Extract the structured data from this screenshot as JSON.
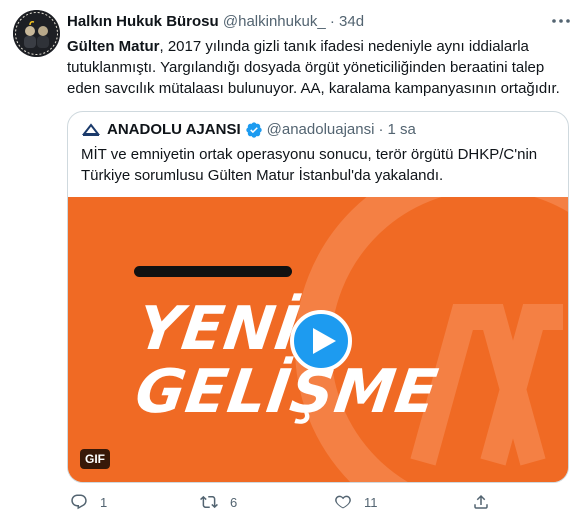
{
  "tweet": {
    "author_name": "Halkın Hukuk Bürosu",
    "author_handle": "@halkinhukuk_",
    "separator": "·",
    "time": "34d",
    "text_bold": "Gülten Matur",
    "text_rest": ", 2017 yılında gizli tanık ifadesi nedeniyle aynı iddialarla tutuklanmıştı. Yargılandığı dosyada örgüt yöneticiliğinden beraatini talep eden savcılık mütalaası bulunuyor. AA, karalama kampanyasının ortağıdır."
  },
  "quote": {
    "name": "ANADOLU AJANSI",
    "handle": "@anadoluajansi",
    "separator": "·",
    "time": "1 sa",
    "text": "MİT ve emniyetin ortak operasyonu sonucu, terör örgütü DHKP/C'nin Türkiye sorumlusu Gülten Matur İstanbul'da yakalandı.",
    "media": {
      "line1": "YENİ",
      "line2": "GELİŞME",
      "badge": "GIF",
      "background_color": "#f06a24"
    }
  },
  "actions": {
    "reply_count": "1",
    "retweet_count": "6",
    "like_count": "11"
  },
  "colors": {
    "verified": "#1d9bf0",
    "secondary_text": "#536471",
    "play_button": "#1d9bf0"
  }
}
